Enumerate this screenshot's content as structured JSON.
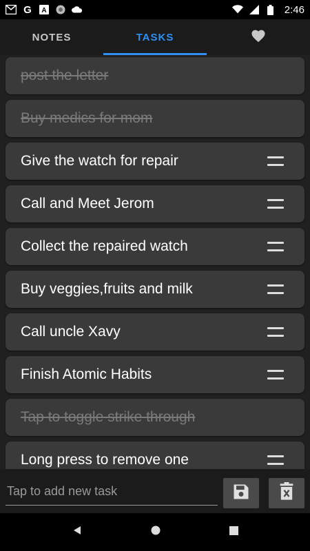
{
  "status_bar": {
    "time": "2:46",
    "left_icons": [
      "gmail-icon",
      "google-icon",
      "font-icon",
      "app-icon",
      "cloud-icon"
    ],
    "right_icons": [
      "wifi-icon",
      "signal-icon",
      "battery-icon"
    ]
  },
  "tabs": [
    {
      "label": "NOTES",
      "active": false
    },
    {
      "label": "TASKS",
      "active": true
    },
    {
      "label": "",
      "icon": "heart-icon",
      "active": false
    }
  ],
  "tasks": [
    {
      "text": "post the letter",
      "done": true
    },
    {
      "text": "Buy medics for mom",
      "done": true
    },
    {
      "text": "Give the watch for repair",
      "done": false
    },
    {
      "text": "Call and Meet Jerom",
      "done": false
    },
    {
      "text": "Collect the repaired watch",
      "done": false
    },
    {
      "text": "Buy veggies,fruits and milk",
      "done": false
    },
    {
      "text": "Call uncle Xavy",
      "done": false
    },
    {
      "text": "Finish Atomic Habits",
      "done": false
    },
    {
      "text": "Tap to toggle strike through",
      "done": true
    },
    {
      "text": "Long press to remove one",
      "done": false
    }
  ],
  "new_task": {
    "placeholder": "Tap to add new task",
    "value": "",
    "save_icon": "save-icon",
    "delete_icon": "delete-icon"
  },
  "colors": {
    "accent": "#2f8ff5",
    "card": "#3a3a3a",
    "background": "#202020"
  }
}
